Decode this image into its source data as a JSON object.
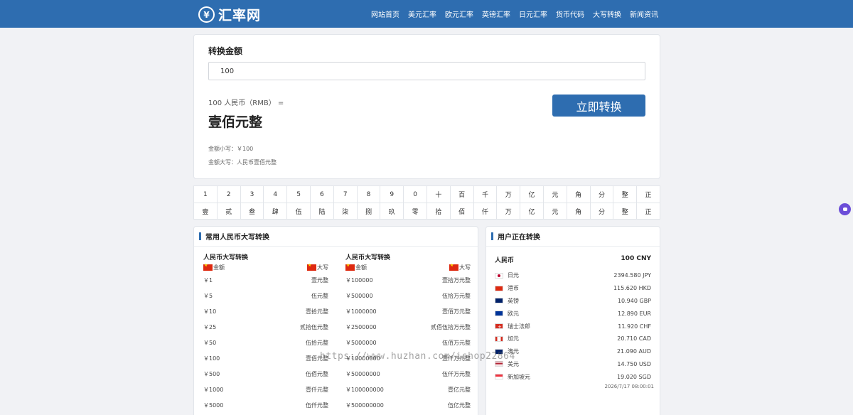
{
  "header": {
    "logo_mark": "¥",
    "logo_text": "汇率网",
    "nav": [
      "网站首页",
      "美元汇率",
      "欧元汇率",
      "英镑汇率",
      "日元汇率",
      "货币代码",
      "大写转换",
      "新闻资讯"
    ]
  },
  "converter": {
    "title": "转换金额",
    "input_value": "100",
    "equation": "100 人民币（RMB） =",
    "result": "壹佰元整",
    "lower_label": "金额小写：￥100",
    "upper_label": "金额大写：人民币壹佰元整",
    "button": "立即转换"
  },
  "digits": {
    "row1": [
      "1",
      "2",
      "3",
      "4",
      "5",
      "6",
      "7",
      "8",
      "9",
      "0",
      "十",
      "百",
      "千",
      "万",
      "亿",
      "元",
      "角",
      "分",
      "整",
      "正"
    ],
    "row2": [
      "壹",
      "贰",
      "叁",
      "肆",
      "伍",
      "陆",
      "柒",
      "捌",
      "玖",
      "零",
      "拾",
      "佰",
      "仟",
      "万",
      "亿",
      "元",
      "角",
      "分",
      "整",
      "正"
    ]
  },
  "common": {
    "title": "常用人民币大写转换",
    "columns": [
      {
        "heading": "人民币大写转换",
        "amount_label": "金额",
        "upper_label": "大写",
        "rows": [
          [
            "￥1",
            "壹元整"
          ],
          [
            "￥5",
            "伍元整"
          ],
          [
            "￥10",
            "壹拾元整"
          ],
          [
            "￥25",
            "贰拾伍元整"
          ],
          [
            "￥50",
            "伍拾元整"
          ],
          [
            "￥100",
            "壹佰元整"
          ],
          [
            "￥500",
            "伍佰元整"
          ],
          [
            "￥1000",
            "壹仟元整"
          ],
          [
            "￥5000",
            "伍仟元整"
          ]
        ]
      },
      {
        "heading": "人民币大写转换",
        "amount_label": "金额",
        "upper_label": "大写",
        "rows": [
          [
            "￥100000",
            "壹拾万元整"
          ],
          [
            "￥500000",
            "伍拾万元整"
          ],
          [
            "￥1000000",
            "壹佰万元整"
          ],
          [
            "￥2500000",
            "贰佰伍拾万元整"
          ],
          [
            "￥5000000",
            "伍佰万元整"
          ],
          [
            "￥10000000",
            "壹仟万元整"
          ],
          [
            "￥50000000",
            "伍仟万元整"
          ],
          [
            "￥100000000",
            "壹亿元整"
          ],
          [
            "￥500000000",
            "伍亿元整"
          ]
        ]
      }
    ]
  },
  "users": {
    "title": "用户正在转换",
    "base_currency": "人民币",
    "base_amount": "100 CNY",
    "rates": [
      {
        "name": "日元",
        "value": "2394.580 JPY",
        "flag": "jp"
      },
      {
        "name": "港币",
        "value": "115.620 HKD",
        "flag": "hk"
      },
      {
        "name": "英镑",
        "value": "10.940 GBP",
        "flag": "gb"
      },
      {
        "name": "欧元",
        "value": "12.890 EUR",
        "flag": "eu"
      },
      {
        "name": "瑞士法郎",
        "value": "11.920 CHF",
        "flag": "ch"
      },
      {
        "name": "加元",
        "value": "20.710 CAD",
        "flag": "ca"
      },
      {
        "name": "澳元",
        "value": "21.090 AUD",
        "flag": "au"
      },
      {
        "name": "美元",
        "value": "14.750 USD",
        "flag": "us"
      },
      {
        "name": "新加坡元",
        "value": "19.020 SGD",
        "flag": "sg"
      }
    ],
    "timestamp": "2026/7/17 08:00:01"
  },
  "watermark": "https://www.huzhan.com/ishop22864"
}
